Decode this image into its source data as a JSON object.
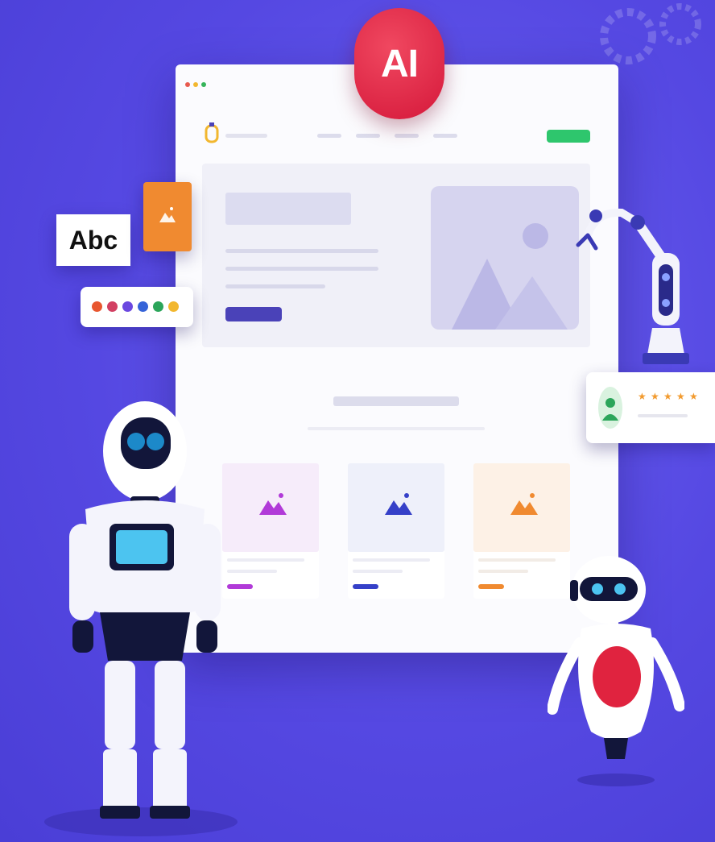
{
  "badge": {
    "label": "AI",
    "color": "#e0233f"
  },
  "text_card": {
    "label": "Abc"
  },
  "palette": {
    "colors": [
      "#e8562f",
      "#d23f62",
      "#6b48e0",
      "#3563d8",
      "#2ba55a",
      "#f2b72f"
    ]
  },
  "review": {
    "rating": 5,
    "max_rating": 5
  },
  "mockup": {
    "window_dots": [
      "#e85a4f",
      "#f2b72f",
      "#36b45a"
    ],
    "nav_links": 4,
    "cta_color": "#2ec66d",
    "cards": [
      {
        "accent": "#b13ad8",
        "tint": "#f6ecfa"
      },
      {
        "accent": "#3540c8",
        "tint": "#eef0fa"
      },
      {
        "accent": "#f08a30",
        "tint": "#fdf1e6"
      }
    ]
  },
  "colors": {
    "background": "#5548e2",
    "primary_button": "#4a42b8"
  }
}
